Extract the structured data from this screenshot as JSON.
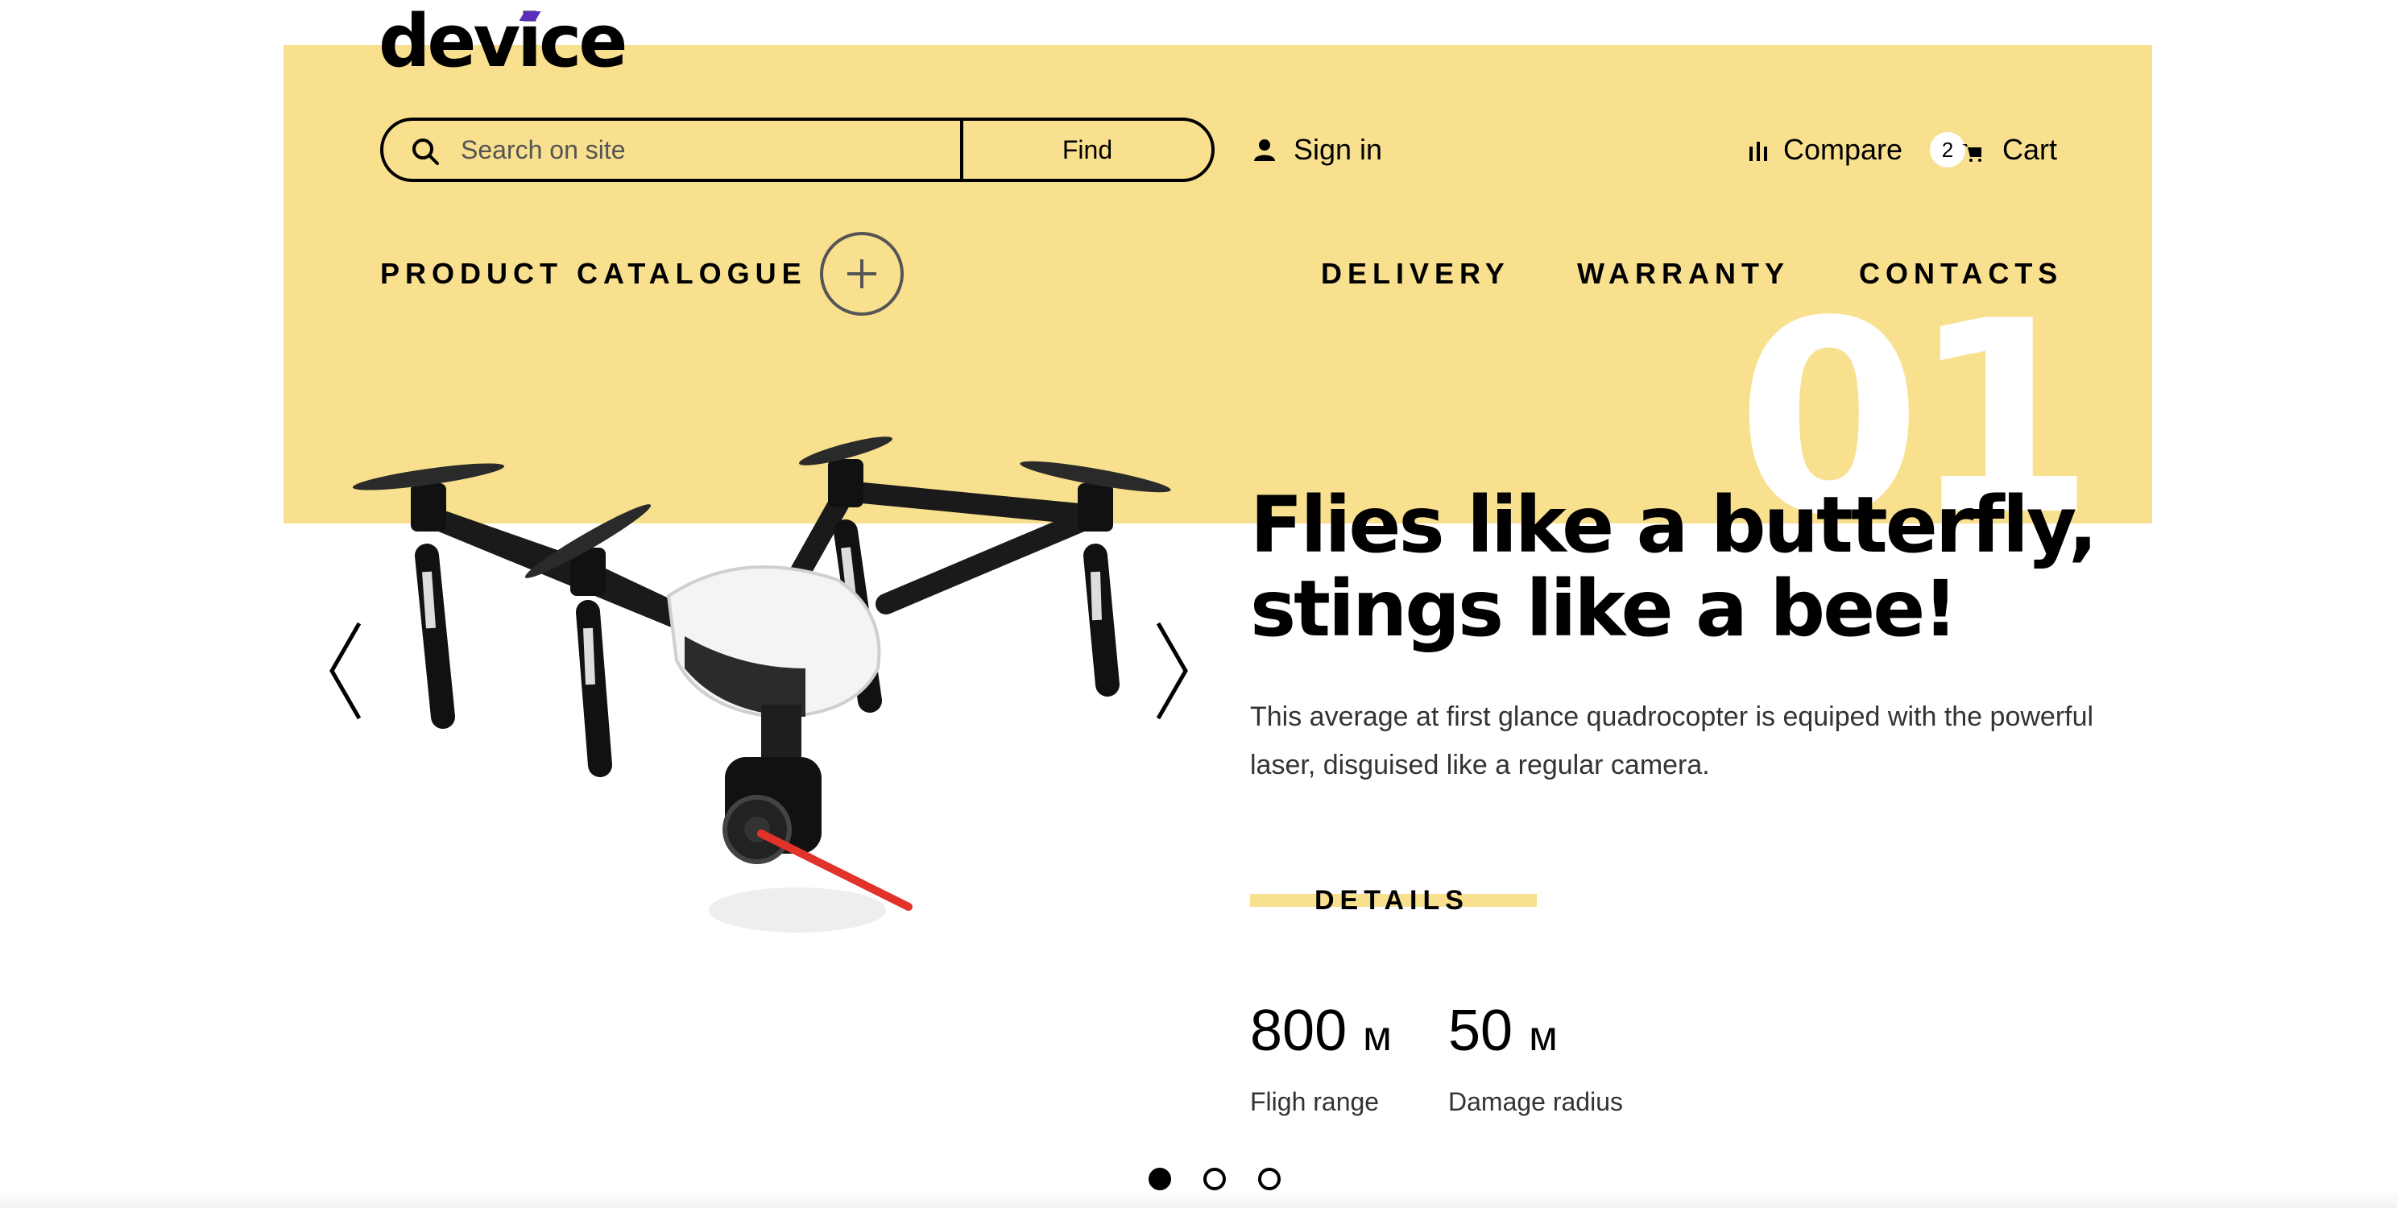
{
  "header": {
    "logo": "device",
    "search": {
      "placeholder": "Search on site",
      "value": "",
      "button_label": "Find"
    },
    "sign_in": "Sign in",
    "compare": "Compare",
    "cart": {
      "label": "Cart",
      "count": "2"
    }
  },
  "nav": {
    "catalogue": "PRODUCT CATALOGUE",
    "items": [
      "DELIVERY",
      "WARRANTY",
      "CONTACTS"
    ]
  },
  "slide": {
    "number": "01",
    "title_line1": "Flies like a butterfly,",
    "title_line2": "stings like a bee!",
    "description": "This average at first glance quadrocopter is equiped with the powerful laser, disguised like a regular camera.",
    "details_label": "DETAILS",
    "stats": [
      {
        "value": "800",
        "unit": "м",
        "label": "Fligh range"
      },
      {
        "value": "50",
        "unit": "м",
        "label": "Damage radius"
      }
    ],
    "pagination": {
      "total": 3,
      "active": 1
    }
  },
  "colors": {
    "accent": "#f8e08e",
    "logo_mark": "#5b2dbd",
    "laser": "#e2332a"
  }
}
